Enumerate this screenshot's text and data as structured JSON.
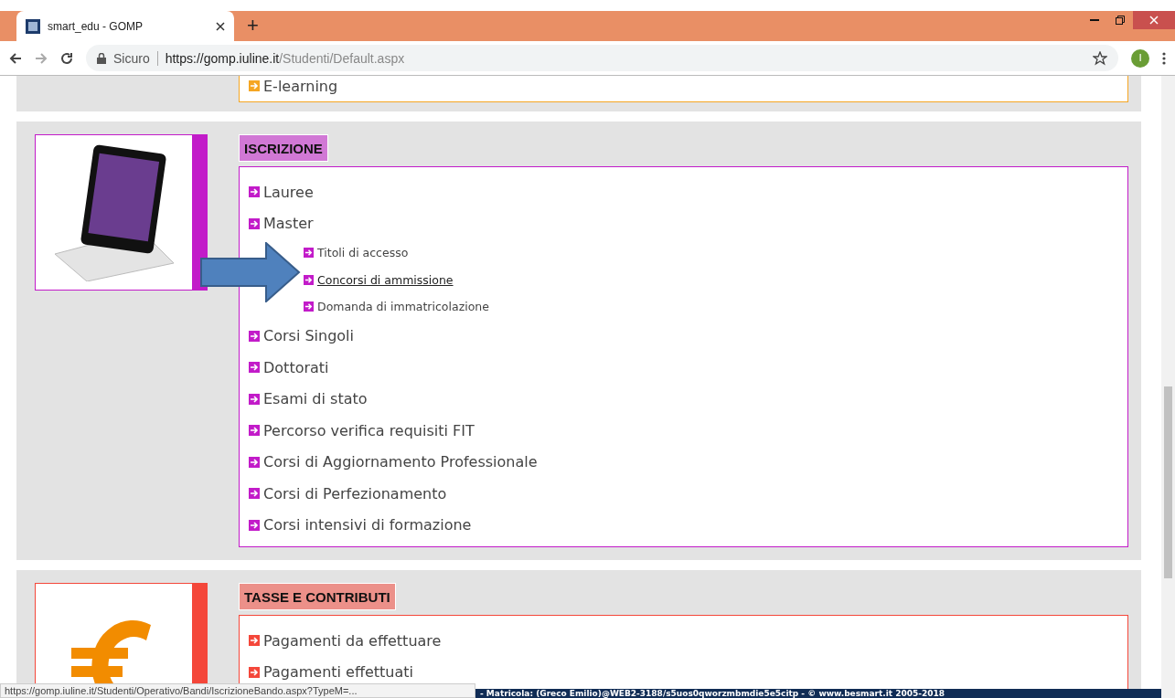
{
  "browser": {
    "tab_title": "smart_edu - GOMP",
    "new_tab": "+",
    "security": "Sicuro",
    "url_host": "https://gomp.iuline.it",
    "url_path": "/Studenti/Default.aspx",
    "avatar": "I"
  },
  "sections": [
    {
      "kind": "partial",
      "color": "#f5a623",
      "items": [
        {
          "label": "E-learning",
          "hovered": false
        }
      ]
    },
    {
      "kind": "full",
      "title": "ISCRIZIONE",
      "color": "#c21bc9",
      "picture": {
        "kind": "tablet"
      },
      "items": [
        {
          "label": "Lauree",
          "hovered": false
        },
        {
          "label": "Master",
          "hovered": false,
          "children": [
            {
              "label": "Titoli di accesso",
              "hovered": false
            },
            {
              "label": "Concorsi di ammissione",
              "hovered": true
            },
            {
              "label": "Domanda di immatricolazione",
              "hovered": false
            }
          ]
        },
        {
          "label": "Corsi Singoli",
          "hovered": false
        },
        {
          "label": "Dottorati",
          "hovered": false
        },
        {
          "label": "Esami di stato",
          "hovered": false
        },
        {
          "label": "Percorso verifica requisiti FIT",
          "hovered": false
        },
        {
          "label": "Corsi di Aggiornamento Professionale",
          "hovered": false
        },
        {
          "label": "Corsi di Perfezionamento",
          "hovered": false
        },
        {
          "label": "Corsi intensivi di formazione",
          "hovered": false
        }
      ]
    },
    {
      "kind": "full",
      "title": "TASSE E CONTRIBUTI",
      "color": "#f4473a",
      "picture": {
        "kind": "euro"
      },
      "items": [
        {
          "label": "Pagamenti da effettuare",
          "hovered": false
        },
        {
          "label": "Pagamenti effettuati",
          "hovered": false
        }
      ]
    }
  ],
  "status": {
    "hover_url": "https://gomp.iuline.it/Studenti/Operativo/Bandi/IscrizioneBando.aspx?TypeM=...",
    "footer": "- Matricola: (Greco Emilio)@WEB2-3188/s5uos0qworzmbmdie5e5citp - © www.besmart.it 2005-2018"
  }
}
